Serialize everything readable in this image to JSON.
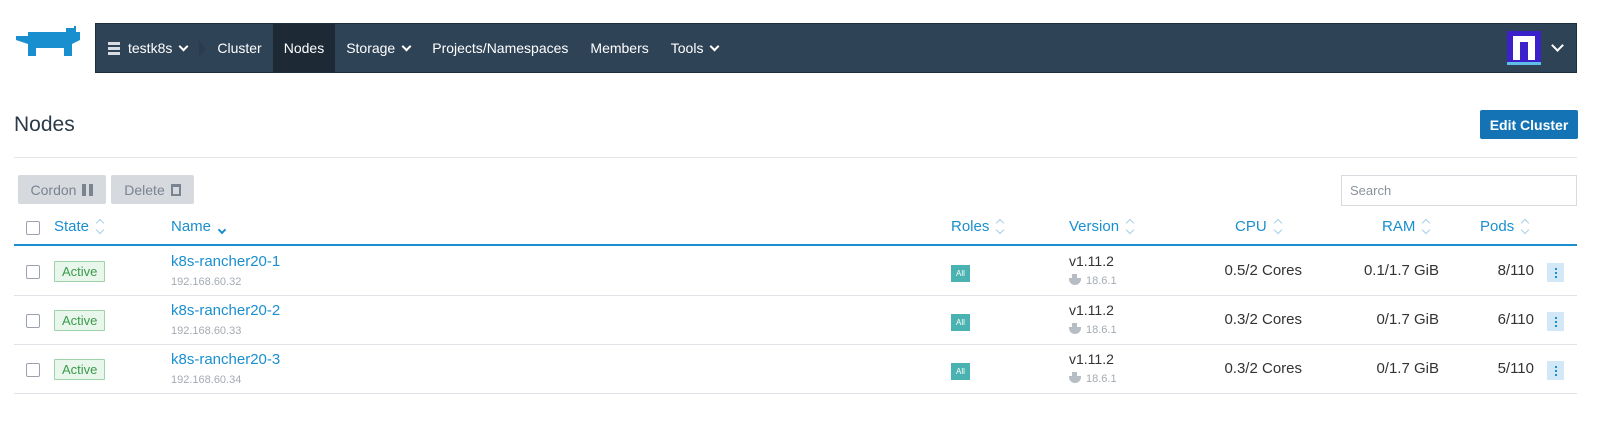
{
  "nav": {
    "cluster_name": "testk8s",
    "items": [
      {
        "label": "Cluster",
        "active": false,
        "dropdown": false
      },
      {
        "label": "Nodes",
        "active": true,
        "dropdown": false
      },
      {
        "label": "Storage",
        "active": false,
        "dropdown": true
      },
      {
        "label": "Projects/Namespaces",
        "active": false,
        "dropdown": false
      },
      {
        "label": "Members",
        "active": false,
        "dropdown": false
      },
      {
        "label": "Tools",
        "active": false,
        "dropdown": true
      }
    ]
  },
  "page": {
    "title": "Nodes",
    "edit_cluster_label": "Edit Cluster"
  },
  "toolbar": {
    "cordon_label": "Cordon",
    "delete_label": "Delete",
    "search_placeholder": "Search"
  },
  "table": {
    "headers": {
      "state": "State",
      "name": "Name",
      "roles": "Roles",
      "version": "Version",
      "cpu": "CPU",
      "ram": "RAM",
      "pods": "Pods"
    },
    "rows": [
      {
        "state": "Active",
        "name": "k8s-rancher20-1",
        "ip": "192.168.60.32",
        "role": "All",
        "version": "v1.11.2",
        "docker": "18.6.1",
        "cpu": "0.5/2 Cores",
        "ram": "0.1/1.7 GiB",
        "pods": "8/110"
      },
      {
        "state": "Active",
        "name": "k8s-rancher20-2",
        "ip": "192.168.60.33",
        "role": "All",
        "version": "v1.11.2",
        "docker": "18.6.1",
        "cpu": "0.3/2 Cores",
        "ram": "0/1.7 GiB",
        "pods": "6/110"
      },
      {
        "state": "Active",
        "name": "k8s-rancher20-3",
        "ip": "192.168.60.34",
        "role": "All",
        "version": "v1.11.2",
        "docker": "18.6.1",
        "cpu": "0.3/2 Cores",
        "ram": "0/1.7 GiB",
        "pods": "5/110"
      }
    ]
  },
  "colors": {
    "nav_bg": "#2f4357",
    "accent": "#1a8fcf",
    "primary_button": "#1473b5",
    "active_state": "#3a9b4a",
    "role_badge": "#4ab2b0"
  }
}
